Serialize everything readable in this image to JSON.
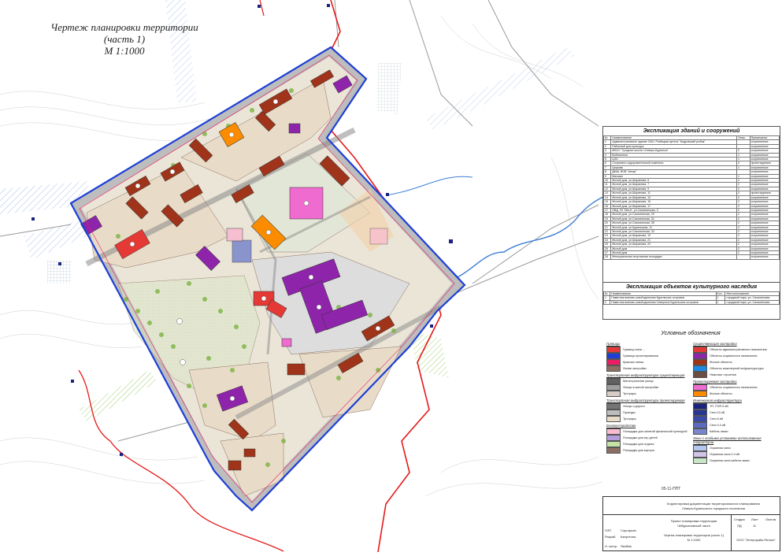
{
  "title": {
    "line1": "Чертеж планировки территории (часть 1)",
    "line2": "М 1:1000"
  },
  "buildings_table": {
    "title": "Экспликация зданий и сооружений",
    "headers": [
      "№",
      "Наименование",
      "Этаж.",
      "Примечание"
    ],
    "rows": [
      [
        "1",
        "Административное здание ОАО, Рыбацкая артель \"Кедровский рыбак\"",
        "",
        "сохраняемое"
      ],
      [
        "2",
        "Районный дом культуры",
        "",
        "сохраняемое"
      ],
      [
        "3",
        "МБОУ \"Средняя школа г.Северо-Курильск\"",
        "2",
        "сохраняемое"
      ],
      [
        "4",
        "Библиотека",
        "1",
        "сохраняемое"
      ],
      [
        "5",
        "ЦЭС",
        "1",
        "сохраняемое"
      ],
      [
        "6",
        "Спортивно-оздоровительный комплекс",
        "2",
        "проектируемое"
      ],
      [
        "7",
        "Церковь",
        "1",
        "сохраняемое"
      ],
      [
        "8",
        "ДМШ, ВОВ \"Ангар\"",
        "",
        "сохраняемое"
      ],
      [
        "9",
        "Магазин",
        "1",
        "сохраняемое"
      ],
      [
        "10",
        "Жилой дом, ул.Шарапова, 5",
        "2",
        "сохраняемое"
      ],
      [
        "11",
        "Жилой дом, ул.Шарапова, 7",
        "2",
        "сохраняемое"
      ],
      [
        "12",
        "Жилой дом, ул.Шарапова, 9",
        "2",
        "сохраняемое"
      ],
      [
        "13",
        "Жилой дом, ул.Шарапова, 11",
        "2",
        "проектируемое"
      ],
      [
        "14",
        "Жилой дом, ул.Шарапова, 13",
        "2",
        "сохраняемое"
      ],
      [
        "15",
        "Жилой дом, ул.Шарапова, 15",
        "2",
        "сохраняемое"
      ],
      [
        "16",
        "Жилой дом, ул.Шарапова, 17",
        "2",
        "сохраняемое"
      ],
      [
        "17",
        "ОВД, УК \"Мега\", ул.Сахалинская, 3",
        "2",
        "сохраняемое"
      ],
      [
        "18",
        "Жилой дом, ул.Сахалинская, 29",
        "2",
        "сохраняемое"
      ],
      [
        "19",
        "Жилой дом, ул.Сахалинская, 31",
        "2",
        "сохраняемое"
      ],
      [
        "20",
        "Жилой дом, ул.Сахалинская, 35",
        "2",
        "сохраняемое"
      ],
      [
        "21",
        "Жилой дом, ул.Курильская, 11",
        "2",
        "сохраняемое"
      ],
      [
        "22",
        "Жилой дом, ул.Сахалинская, 33",
        "2",
        "сохраняемое"
      ],
      [
        "23",
        "Жилой дом, ул.Шарапова, 19",
        "2",
        "сохраняемое"
      ],
      [
        "24",
        "Жилой дом, ул.Шарапова, 21",
        "2",
        "сохраняемое"
      ],
      [
        "25",
        "Жилой дом, ул.Шарапова, 23",
        "2",
        "сохраняемое"
      ],
      [
        "26",
        "Жилой дом",
        "2",
        "сохраняемое"
      ],
      [
        "27",
        "Жилой дом",
        "2",
        "сохраняемое"
      ],
      [
        "28",
        "Мемориальная спортивная площадка",
        "",
        "сохраняемое"
      ]
    ]
  },
  "heritage_table": {
    "title": "Экспликация объектов культурного наследия",
    "headers": [
      "№",
      "Наименование",
      "Кол.",
      "Местоположение"
    ],
    "rows": [
      [
        "1",
        "Памятник воинам-освободителям Курильских островов",
        "1",
        "городской парк, ул. Сахалинская"
      ],
      [
        "2",
        "Памятник воинам-освободителям Северных Курильских островов",
        "1",
        "городской парк, ул. Сахалинская"
      ]
    ]
  },
  "legend": {
    "title": "Условные обозначения",
    "left": [
      {
        "type": "heading",
        "label": "Границы"
      },
      {
        "swatch": "#e53935",
        "label": "Граница зоны ... "
      },
      {
        "swatch": "#1e3fd6",
        "label": "Границы проектирования"
      },
      {
        "swatch": "#e91e63",
        "label": "Красная линия"
      },
      {
        "swatch": "#8d6e63",
        "label": "Линии застройки"
      },
      {
        "type": "heading",
        "label": "Транспортная инфраструктура существующая"
      },
      {
        "swatch": "#616161",
        "label": "Магистральная улица"
      },
      {
        "swatch": "#9e9e9e",
        "label": "Улицы в жилой застройке"
      },
      {
        "swatch": "#d7ccc8",
        "label": "Тротуары"
      },
      {
        "type": "heading",
        "label": "Транспортная инфраструктура проектируемая"
      },
      {
        "swatch": "#757575",
        "label": "Улицы и дороги"
      },
      {
        "swatch": "#bdbdbd",
        "label": "Проезды"
      },
      {
        "swatch": "#e8dcc8",
        "label": "Тротуары"
      },
      {
        "type": "heading",
        "label": "Благоустройство"
      },
      {
        "swatch": "#f8bbd0",
        "label": "Площадки для занятий физической культурой"
      },
      {
        "swatch": "#b39ddb",
        "label": "Площадки для игр детей"
      },
      {
        "swatch": "#c5e1a5",
        "label": "Площадки для отдыха"
      },
      {
        "swatch": "#8d6e63",
        "label": "Площадки для мусора"
      }
    ],
    "right": [
      {
        "type": "heading",
        "label": "Существующая застройка"
      },
      {
        "swatch": "#e53935",
        "label": "Объекты административного назначения"
      },
      {
        "swatch": "#8e24aa",
        "label": "Объекты социального назначения"
      },
      {
        "swatch": "#a0341a",
        "label": "Жилые объекты"
      },
      {
        "swatch": "#1e88e5",
        "label": "Объекты инженерной инфраструктуры"
      },
      {
        "swatch": "#6d4c41",
        "label": "Нежилые строения"
      },
      {
        "type": "heading",
        "label": "Проектируемая застройка"
      },
      {
        "swatch": "#f06bd0",
        "label": "Объекты социального назначения"
      },
      {
        "swatch": "#fb8c00",
        "label": "Жилые объекты"
      },
      {
        "type": "heading",
        "label": "Инженерная инфраструктура"
      },
      {
        "swatch": "#1a237e",
        "label": "ТП, ПЭП 6 кВ"
      },
      {
        "swatch": "#283593",
        "label": "Сети 10 кВ"
      },
      {
        "swatch": "#3949ab",
        "label": "Сети 6 кВ"
      },
      {
        "swatch": "#5c6bc0",
        "label": "Сети 0.4 кВ"
      },
      {
        "swatch": "#7986cb",
        "label": "Кабель связи"
      },
      {
        "type": "heading",
        "label": "Зоны с особыми условиями использования территории"
      },
      {
        "swatch": "#b3c7f0",
        "label": "Охранная зона"
      },
      {
        "swatch": "#d1c4e9",
        "label": "Охранная зона 0.4 кВ"
      },
      {
        "swatch": "#c8e6c9",
        "label": "Охранная зона кабеля связи"
      }
    ]
  },
  "stamp": {
    "code": "05-11-ППТ",
    "project_line1": "Корректировка документации территориального планирования",
    "project_line2": "Северо-Курильского городского поселения",
    "sheet_title_line1": "Проект планировки территории",
    "sheet_title_line2": "Чебуркаловской части",
    "sheet_name": "Чертеж планировки территории (часть 1)",
    "scale": "М 1:1000",
    "stage_label": "Стадия",
    "sheet_label": "Лист",
    "sheets_label": "Листов",
    "stage": "ПД",
    "sheet": "11",
    "org": "ООО \"Энтерпрайз-Регион\"",
    "roles": [
      "ГИП",
      "Разраб.",
      "Н. контр."
    ],
    "names": [
      "Соргорьев",
      "Капустина",
      "Якобюк"
    ]
  }
}
